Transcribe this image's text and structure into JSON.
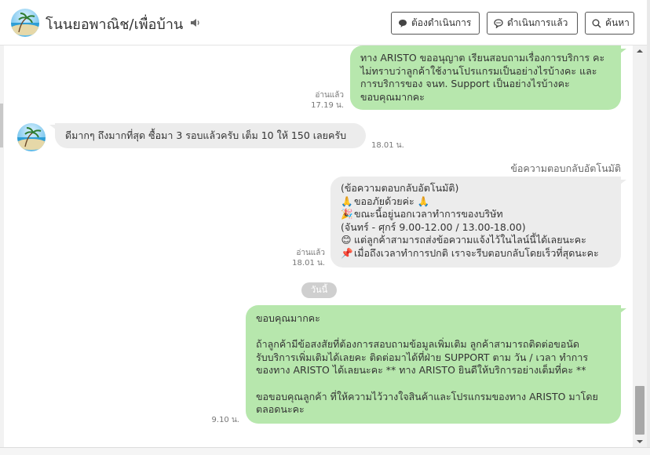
{
  "header": {
    "title": "โนนยอพาณิช/เพื่อบ้าน",
    "buttons": {
      "todo": "ต้องดำเนินการ",
      "done": "ดำเนินการแล้ว",
      "search": "ค้นหา"
    },
    "icons": [
      "avatar-beach",
      "speaker-icon",
      "chat-bubble-icon",
      "chat-bubble-dots-icon",
      "search-icon"
    ]
  },
  "messages": [
    {
      "side": "outgoing",
      "lines": [
        "ทาง ARISTO ขออนุญาต เรียนสอบถามเรื่องการบริการ คะ",
        "ไม่ทราบว่าลูกค้าใช้งานโปรแกรมเป็นอย่างไรบ้างคะ และ",
        "การบริการของ จนท. Support เป็นอย่างไรบ้างคะ",
        "ขอบคุณมากคะ"
      ],
      "read": "อ่านแล้ว",
      "time": "17.19 น."
    },
    {
      "side": "incoming",
      "text": "ดีมากๆ ถึงมากที่สุด ซื้อมา 3 รอบแล้วครับ เต็ม 10 ให้ 150 เลยครับ",
      "time": "18.01 น."
    },
    {
      "side": "outgoing",
      "label": "ข้อความตอบกลับอัตโนมัติ",
      "lines": [
        "(ข้อความตอบกลับอัตโนมัติ)",
        "ขออภัยด้วยค่ะ",
        "ขณะนี้อยู่นอกเวลาทำการของบริษัท",
        "(จันทร์ - ศุกร์ 9.00-12.00 / 13.00-18.00)",
        "แต่ลูกค้าสามารถส่งข้อความแจ้งไว้ในไลน์นี้ได้เลยนะคะ",
        "เมื่อถึงเวลาทำการปกติ เราจะรีบตอบกลับโดยเร็วที่สุดนะคะ"
      ],
      "emojis": [
        "🙏",
        "🙏",
        "🎉",
        "😊",
        "📌"
      ],
      "read": "อ่านแล้ว",
      "time": "18.01 น."
    },
    {
      "side": "divider",
      "text": "วันนี้"
    },
    {
      "side": "outgoing",
      "lines": [
        "ขอบคุณมากคะ",
        "",
        "ถ้าลูกค้ามีข้อสงสัยที่ต้องการสอบถามข้อมูลเพิ่มเติม ลูกค้าสามารถติดต่อขอนัด",
        "รับบริการเพิ่มเติมได้เลยคะ ติดต่อมาได้ที่ฝ่าย SUPPORT ตาม วัน / เวลา ทำการ",
        "ของทาง ARISTO ได้เลยนะคะ ** ทาง ARISTO ยินดีให้บริการอย่างเต็มที่คะ **",
        "",
        "ขอขอบคุณลูกค้า ที่ให้ความไว้วางใจสินค้าและโปรแกรมของทาง ARISTO มาโดย",
        "ตลอดนะคะ"
      ],
      "time": "9.10 น."
    }
  ],
  "colors": {
    "outgoing_bubble": "#b7e7ad",
    "incoming_bubble": "#ececec",
    "divider": "#cfcfcf"
  }
}
